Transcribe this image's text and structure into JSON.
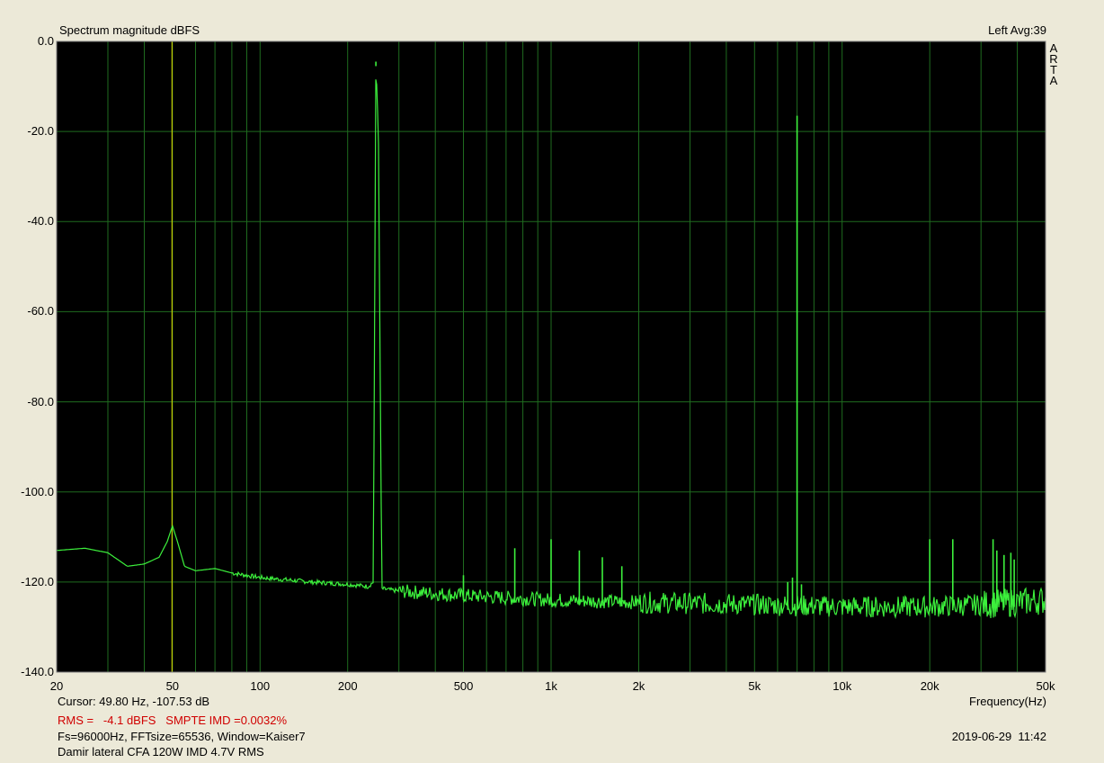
{
  "title": "Spectrum magnitude dBFS",
  "top_right": "Left  Avg:39",
  "side_logo": [
    "A",
    "R",
    "T",
    "A"
  ],
  "xlabel": "Frequency(Hz)",
  "cursor_text": "Cursor: 49.80 Hz, -107.53 dB",
  "rms_text": "RMS =   -4.1 dBFS   SMPTE IMD =0.0032%",
  "fs_text": "Fs=96000Hz, FFTsize=65536, Window=Kaiser7",
  "desc_text": "Damir lateral CFA 120W IMD 4.7V RMS",
  "date_text": "2019-06-29  11:42",
  "colors": {
    "background": "#ece9d8",
    "plot_bg": "#000000",
    "grid": "#1f6b1f",
    "trace": "#3cf03c",
    "cursor": "#e6e600",
    "rms_text": "#d00000"
  },
  "chart_data": {
    "type": "line",
    "title": "Spectrum magnitude dBFS",
    "xlabel": "Frequency(Hz)",
    "ylabel": "",
    "xscale": "log",
    "xlim": [
      20,
      50000
    ],
    "ylim": [
      -140,
      0
    ],
    "grid": true,
    "y_ticks": [
      "0.0",
      "-20.0",
      "-40.0",
      "-60.0",
      "-80.0",
      "-100.0",
      "-120.0",
      "-140.0"
    ],
    "x_ticks": [
      {
        "value": 20,
        "label": "20"
      },
      {
        "value": 50,
        "label": "50"
      },
      {
        "value": 100,
        "label": "100"
      },
      {
        "value": 200,
        "label": "200"
      },
      {
        "value": 500,
        "label": "500"
      },
      {
        "value": 1000,
        "label": "1k"
      },
      {
        "value": 2000,
        "label": "2k"
      },
      {
        "value": 5000,
        "label": "5k"
      },
      {
        "value": 10000,
        "label": "10k"
      },
      {
        "value": 20000,
        "label": "20k"
      },
      {
        "value": 50000,
        "label": "50k"
      }
    ],
    "cursor": {
      "x": 49.8,
      "y": -107.53
    },
    "series": [
      {
        "x": [
          20,
          25,
          30,
          35,
          40,
          45,
          48,
          50,
          52,
          55,
          60,
          70,
          80,
          100,
          150,
          200,
          235,
          245,
          250,
          255,
          262,
          300,
          500,
          1000,
          2000,
          5000,
          10000,
          20000,
          30000,
          40000,
          50000
        ],
        "y": [
          -113,
          -112.5,
          -113.5,
          -116.5,
          -116,
          -114.5,
          -111,
          -107.5,
          -111,
          -116.5,
          -117.5,
          -117,
          -118,
          -119,
          -120,
          -120.5,
          -121,
          -120,
          -4.5,
          -20,
          -121.5,
          -122,
          -123,
          -124,
          -124.5,
          -125,
          -125.5,
          -125.5,
          -125,
          -124.5,
          -124
        ]
      }
    ],
    "peaks": [
      {
        "x": 250,
        "y": -4.5
      },
      {
        "x": 7000,
        "y": -16.5
      },
      {
        "x": 750,
        "y": -112.5
      },
      {
        "x": 1000,
        "y": -110.5
      },
      {
        "x": 1250,
        "y": -113
      },
      {
        "x": 1500,
        "y": -114.5
      },
      {
        "x": 1750,
        "y": -116.5
      },
      {
        "x": 500,
        "y": -118.5
      },
      {
        "x": 6750,
        "y": -119
      },
      {
        "x": 6500,
        "y": -120
      },
      {
        "x": 7250,
        "y": -120.5
      },
      {
        "x": 20000,
        "y": -110.5
      },
      {
        "x": 24000,
        "y": -110.5
      },
      {
        "x": 33000,
        "y": -110.5
      },
      {
        "x": 34000,
        "y": -113
      },
      {
        "x": 36000,
        "y": -114
      },
      {
        "x": 38000,
        "y": -113.5
      },
      {
        "x": 39000,
        "y": -115
      }
    ]
  }
}
